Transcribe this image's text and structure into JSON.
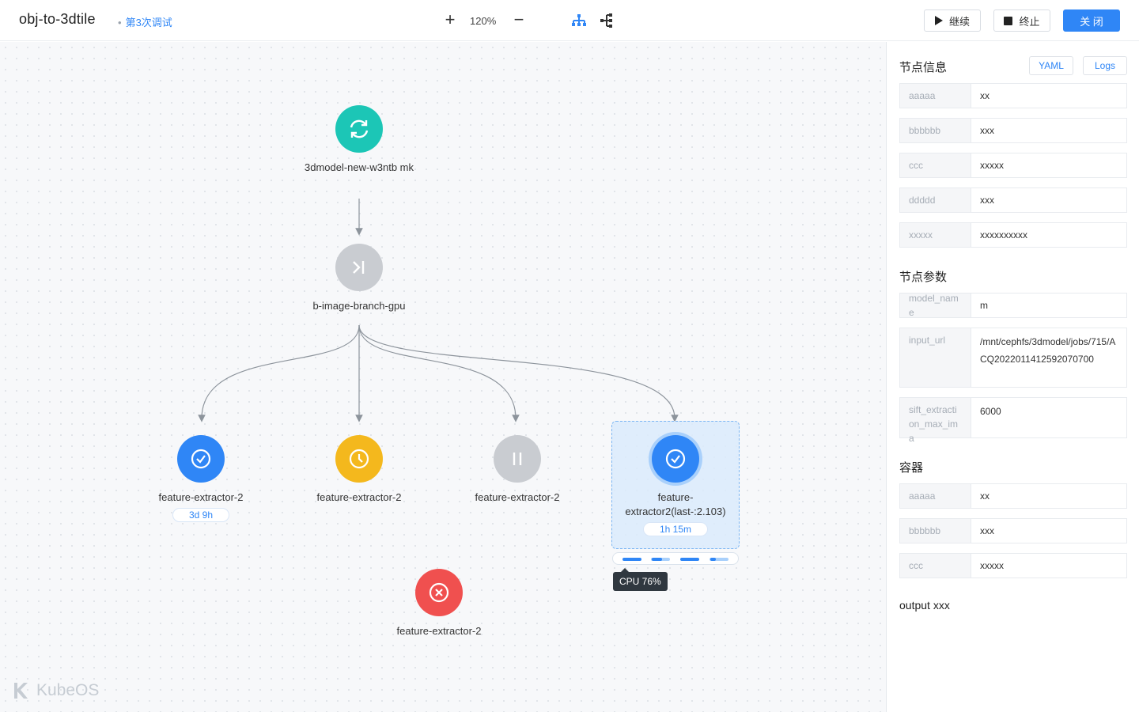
{
  "header": {
    "title": "obj-to-3dtile",
    "run_badge": "第3次调试",
    "zoom_in": "+",
    "zoom_level": "120%",
    "zoom_out": "−",
    "continue_label": "继续",
    "stop_label": "终止",
    "close_label": "关 闭"
  },
  "graph": {
    "nodes": [
      {
        "label": "3dmodel-new-w3ntb mk",
        "status": "running",
        "icon": "sync-icon"
      },
      {
        "label": "b-image-branch-gpu",
        "status": "skipped",
        "icon": "skip-icon"
      },
      {
        "label": "feature-extractor-2",
        "status": "succeeded",
        "icon": "check-icon",
        "duration": "3d  9h"
      },
      {
        "label": "feature-extractor-2",
        "status": "pending",
        "icon": "clock-icon"
      },
      {
        "label": "feature-extractor-2",
        "status": "paused",
        "icon": "pause-icon"
      },
      {
        "label": "feature-extractor2(last-:2.103)",
        "label_line1": "feature-",
        "label_line2": "extractor2(last-:2.103)",
        "status": "succeeded",
        "icon": "check-icon",
        "duration": "1h  15m",
        "selected": true
      },
      {
        "label": "feature-extractor-2",
        "status": "failed",
        "icon": "close-circle-icon"
      }
    ],
    "tooltip": "CPU   76%",
    "brand": "KubeOS"
  },
  "colors": {
    "accent": "#2f86f6",
    "running": "#1cc6b6",
    "skipped": "#c9ccd1",
    "succeeded": "#2f86f6",
    "pending": "#f4b81d",
    "failed": "#f0504f"
  },
  "panel": {
    "node_info_title": "节点信息",
    "yaml_tab": "YAML",
    "logs_tab": "Logs",
    "node_info": [
      {
        "key": "aaaaa",
        "value": "xx"
      },
      {
        "key": "bbbbbb",
        "value": "xxx"
      },
      {
        "key": "ccc",
        "value": "xxxxx"
      },
      {
        "key": "ddddd",
        "value": "xxx"
      },
      {
        "key": "xxxxx",
        "value": "xxxxxxxxxx"
      }
    ],
    "params_title": "节点参数",
    "params": [
      {
        "key": "model_name",
        "value": "m"
      },
      {
        "key": "input_url",
        "value": "/mnt/cephfs/3dmodel/jobs/715/ACQ2022011412592070700"
      },
      {
        "key": "sift_extraction_max_ima",
        "value": "6000"
      }
    ],
    "container_title": "容器",
    "container": [
      {
        "key": "aaaaa",
        "value": "xx"
      },
      {
        "key": "bbbbbb",
        "value": "xxx"
      },
      {
        "key": "ccc",
        "value": "xxxxx"
      }
    ],
    "output": "output xxx"
  }
}
